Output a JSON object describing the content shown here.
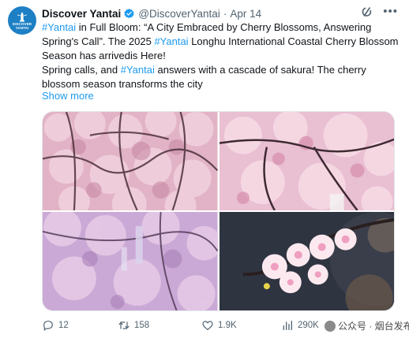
{
  "account": {
    "display_name": "Discover Yantai",
    "handle": "@DiscoverYantai",
    "separator": "·",
    "date": "Apr 14",
    "avatar_text": [
      "DISCOVER",
      "YANTAI"
    ]
  },
  "tweet": {
    "line1_tag": "#Yantai",
    "line1_rest": " in Full Bloom: “A City Embraced by Cherry Blossoms, Answering Spring's Call”. The 2025 ",
    "line1_tag2": "#Yantai",
    "line1_tail": " Longhu International Coastal Cherry Blossom Season has arrivedis Here!",
    "line2_start": "Spring calls, and ",
    "line2_tag": "#Yantai",
    "line2_rest": " answers with a cascade of sakura! The cherry blossom season transforms the city",
    "show_more": "Show more"
  },
  "media": [
    {
      "name": "cherry-blossom-branches-photo"
    },
    {
      "name": "cherry-blossom-closeup-photo"
    },
    {
      "name": "cherry-blossom-tree-photo"
    },
    {
      "name": "cherry-blossom-sunlit-photo"
    }
  ],
  "metrics": {
    "replies": "12",
    "retweets": "158",
    "likes": "1.9K",
    "views": "290K"
  },
  "watermark": "公众号 · 烟台发布",
  "colors": {
    "accent": "#1d9bf0",
    "text_secondary": "#536471",
    "verified": "#1d9bf0"
  },
  "icons": [
    "verified-icon",
    "grok-icon",
    "more-icon",
    "reply-icon",
    "retweet-icon",
    "like-icon",
    "views-icon"
  ]
}
